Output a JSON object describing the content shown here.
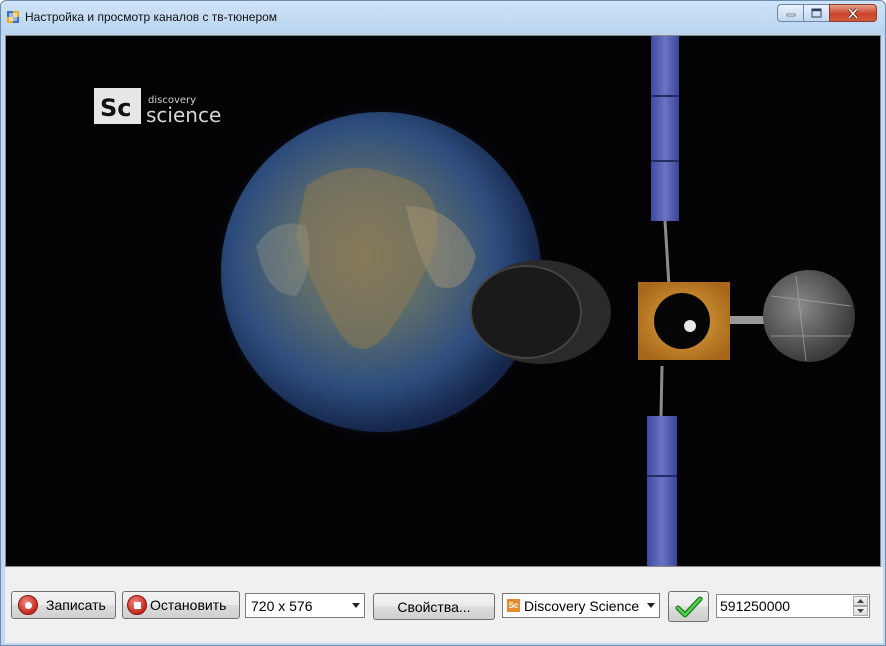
{
  "window": {
    "title": "Настройка и просмотр каналов с тв-тюнером",
    "icon": "app-window-icon"
  },
  "video": {
    "channel_logo_mark": "Sc",
    "channel_logo_small": "discovery",
    "channel_logo_large": "science"
  },
  "controls": {
    "record_label": "Записать",
    "stop_label": "Остановить",
    "resolution_selected": "720 x 576",
    "properties_label": "Свойства...",
    "channel_icon_text": "Sc",
    "channel_selected": "Discovery Science",
    "apply_icon": "checkmark-icon",
    "frequency_value": "591250000"
  },
  "colors": {
    "record_red": "#c8281d",
    "check_green": "#2e9e2e",
    "close_red": "#c9452a"
  }
}
